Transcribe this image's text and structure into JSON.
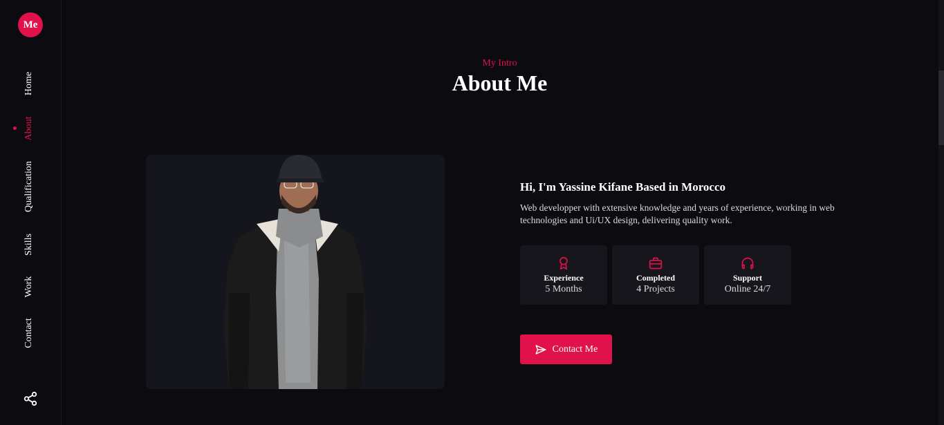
{
  "sidebar": {
    "logo": "Me",
    "nav": [
      {
        "label": "Home"
      },
      {
        "label": "About"
      },
      {
        "label": "Qualification"
      },
      {
        "label": "Skills"
      },
      {
        "label": "Work"
      },
      {
        "label": "Contact"
      }
    ],
    "active_item": "About",
    "share_icon": "share-icon"
  },
  "section": {
    "subtitle": "My Intro",
    "title": "About Me"
  },
  "about": {
    "heading": "Hi, I'm Yassine Kifane Based in Morocco",
    "description": "Web developper with extensive knowledge and years of experience, working in web technologies and Ui/UX design, delivering quality work.",
    "stats": [
      {
        "icon": "award-icon",
        "label": "Experience",
        "value": "5 Months"
      },
      {
        "icon": "briefcase-icon",
        "label": "Completed",
        "value": "4 Projects"
      },
      {
        "icon": "headphones-icon",
        "label": "Support",
        "value": "Online 24/7"
      }
    ],
    "contact_button": {
      "icon": "send-icon",
      "label": "Contact Me"
    }
  },
  "colors": {
    "accent": "#e1114c",
    "background": "#0c0b10",
    "card": "#17161d"
  }
}
